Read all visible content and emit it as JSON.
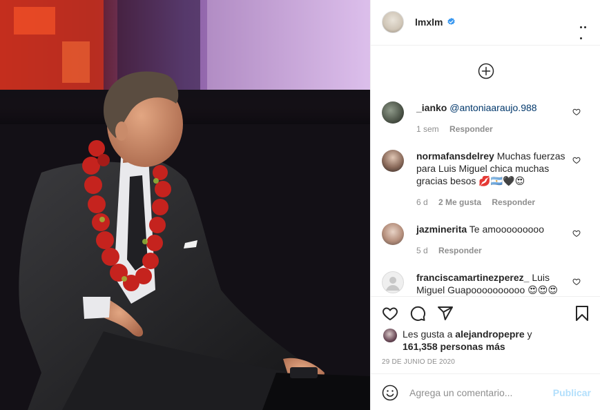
{
  "header": {
    "username": "lmxlm",
    "verified_icon": "verified-badge-icon",
    "more_icon": "more-options-icon"
  },
  "comments": {
    "load_more_icon": "plus-circle-icon",
    "items": [
      {
        "user": "_ianko",
        "mention": "@antoniaaraujo.988",
        "text": "",
        "time": "1 sem",
        "likes": "",
        "reply": "Responder"
      },
      {
        "user": "normafansdelrey",
        "mention": "",
        "text": "Muchas fuerzas para Luis Miguel chica muchas gracias besos 💋🇦🇷🖤😍",
        "time": "6 d",
        "likes": "2 Me gusta",
        "reply": "Responder"
      },
      {
        "user": "jazminerita",
        "mention": "",
        "text": "Te amooooooooo",
        "time": "5 d",
        "likes": "",
        "reply": "Responder"
      },
      {
        "user": "franciscamartinezperez_",
        "mention": "",
        "text": "Luis Miguel Guapoooooooooo 😍😍😍",
        "time": "",
        "likes": "",
        "reply": ""
      }
    ]
  },
  "actions": {
    "like_icon": "heart-icon",
    "comment_icon": "comment-bubble-icon",
    "share_icon": "paper-plane-icon",
    "save_icon": "bookmark-icon"
  },
  "likes": {
    "prefix": "Les gusta a",
    "first_user": "alejandropepre",
    "joiner": "y",
    "count_text": "161,358 personas más"
  },
  "date": "29 DE JUNIO DE 2020",
  "add_comment": {
    "placeholder": "Agrega un comentario...",
    "publish_label": "Publicar",
    "emoji_icon": "emoji-smile-icon"
  },
  "colors": {
    "text": "#262626",
    "muted": "#8e8e8e",
    "verified": "#3897f0",
    "publish_disabled": "#b2dffc",
    "mention": "#00376b"
  }
}
